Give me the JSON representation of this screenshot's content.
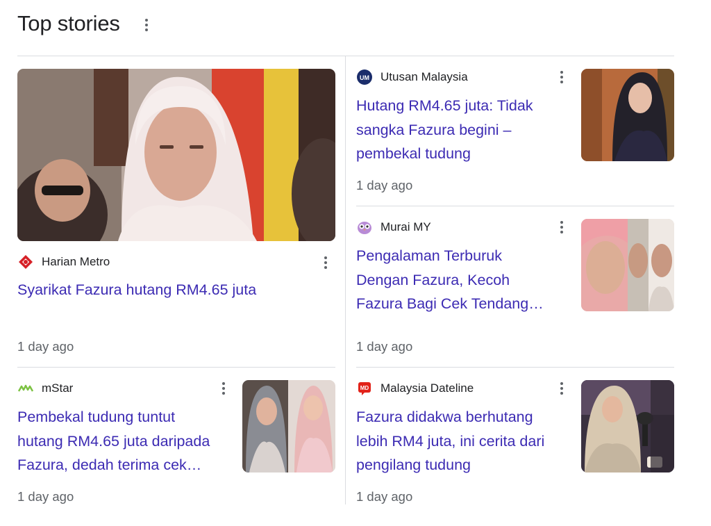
{
  "header": {
    "title": "Top stories"
  },
  "stories": [
    {
      "source": "Harian Metro",
      "headline": "Syarikat Fazura hutang RM4.65 juta",
      "time": "1 day ago"
    },
    {
      "source": "Utusan Malaysia",
      "logo_text": "UM",
      "headline_lines": [
        "Hutang RM4.65 juta: Tidak",
        "sangka Fazura begini –",
        "pembekal tudung"
      ],
      "time": "1 day ago"
    },
    {
      "source": "Murai MY",
      "headline_lines": [
        "Pengalaman Terburuk",
        "Dengan Fazura, Kecoh",
        "Fazura Bagi Cek Tendang…"
      ],
      "time": "1 day ago"
    },
    {
      "source": "mStar",
      "headline_lines": [
        "Pembekal tudung tuntut",
        "hutang RM4.65 juta daripada",
        "Fazura, dedah terima cek…"
      ],
      "time": "1 day ago"
    },
    {
      "source": "Malaysia Dateline",
      "logo_text": "MD",
      "headline_lines": [
        "Fazura didakwa berhutang",
        "lebih RM4 juta, ini cerita dari",
        "pengilang tudung"
      ],
      "time": "1 day ago"
    }
  ],
  "colors": {
    "headline": "#3c2bb3",
    "meta": "#5f6368",
    "divider": "#dadce0"
  }
}
